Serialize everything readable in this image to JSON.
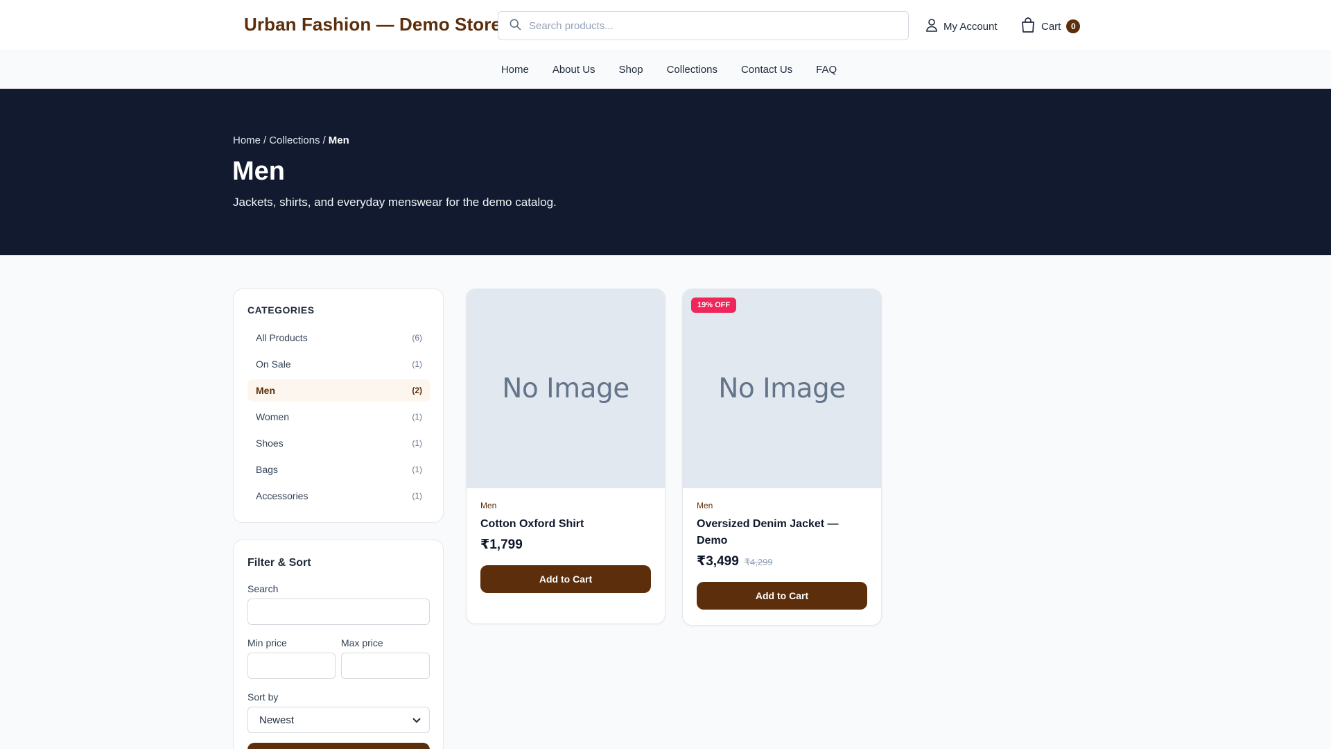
{
  "header": {
    "logo": "Urban Fashion — Demo Store",
    "search_placeholder": "Search products...",
    "account_label": "My Account",
    "cart_label": "Cart",
    "cart_count": "0",
    "brand_color": "#5c2e0b"
  },
  "nav": {
    "items": [
      "Home",
      "About Us",
      "Shop",
      "Collections",
      "Contact Us",
      "FAQ"
    ]
  },
  "hero": {
    "breadcrumb": [
      "Home",
      "Collections",
      "Men"
    ],
    "breadcrumb_sep": "/",
    "title": "Men",
    "subtitle": "Jackets, shirts, and everyday menswear for the demo catalog."
  },
  "categories": {
    "title": "CATEGORIES",
    "items": [
      {
        "label": "All Products",
        "count": "(6)"
      },
      {
        "label": "On Sale",
        "count": "(1)"
      },
      {
        "label": "Men",
        "count": "(2)"
      },
      {
        "label": "Women",
        "count": "(1)"
      },
      {
        "label": "Shoes",
        "count": "(1)"
      },
      {
        "label": "Bags",
        "count": "(1)"
      },
      {
        "label": "Accessories",
        "count": "(1)"
      }
    ],
    "active": "Men"
  },
  "filters": {
    "title": "Filter & Sort",
    "search_label": "Search",
    "search_value": "",
    "min_label": "Min price",
    "min_value": "",
    "max_label": "Max price",
    "max_value": "",
    "sort_label": "Sort by",
    "sort_value": "Newest"
  },
  "products": [
    {
      "image_text": "No Image",
      "badge": "",
      "category": "Men",
      "name": "Cotton Oxford Shirt",
      "price": "₹1,799",
      "old_price": "",
      "button": "Add to Cart"
    },
    {
      "image_text": "No Image",
      "badge": "19% OFF",
      "category": "Men",
      "name": "Oversized Denim Jacket — Demo",
      "price": "₹3,499",
      "old_price": "₹4,299",
      "button": "Add to Cart"
    }
  ]
}
